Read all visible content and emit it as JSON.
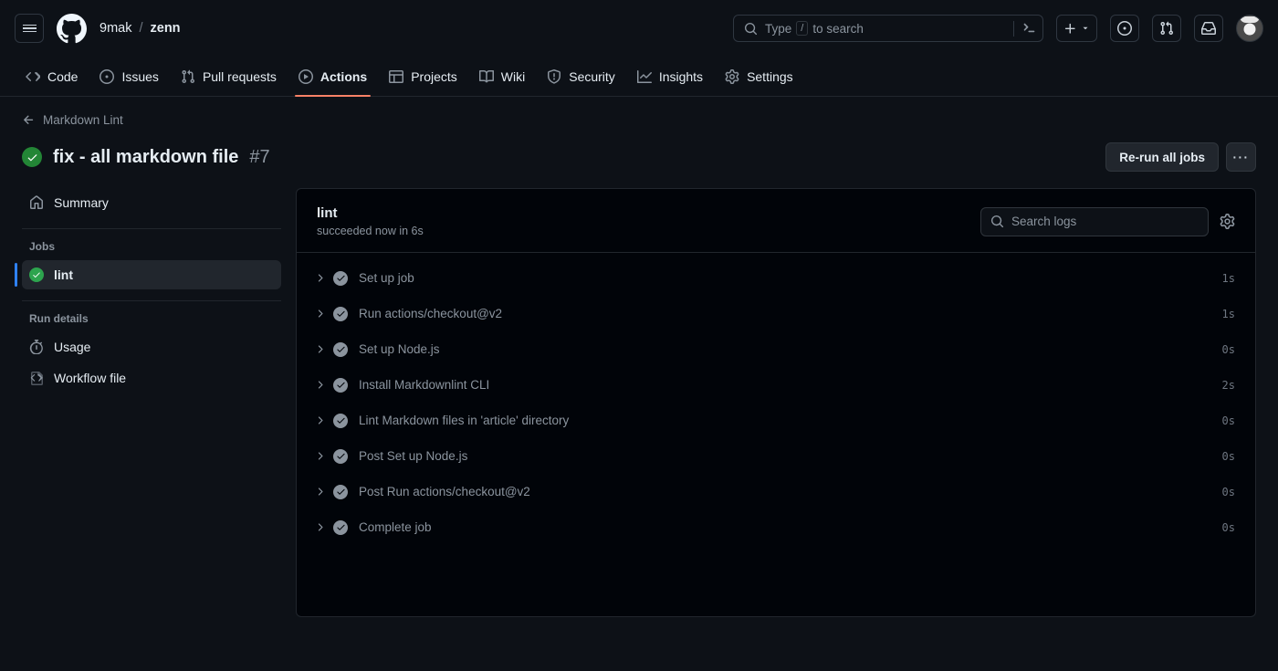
{
  "header": {
    "menu_icon": "hamburger-icon",
    "logo_icon": "github-logo-icon",
    "owner": "9mak",
    "separator": "/",
    "repo": "zenn",
    "search": {
      "placeholder_before": "Type",
      "slash_key": "/",
      "placeholder_after": "to search",
      "value": "",
      "search_icon": "search-icon",
      "terminal_icon": "terminal-icon"
    },
    "create_new_label": "+",
    "create_new_icon": "plus-icon",
    "create_new_chevron": "chevron-down-icon",
    "issues_icon": "issue-opened-icon",
    "pull_requests_icon": "git-pull-request-icon",
    "notifications_icon": "inbox-icon",
    "avatar_icon": "avatar"
  },
  "nav": {
    "items": [
      {
        "label": "Code",
        "icon": "code-icon",
        "active": false
      },
      {
        "label": "Issues",
        "icon": "issue-opened-icon",
        "active": false
      },
      {
        "label": "Pull requests",
        "icon": "git-pull-request-icon",
        "active": false
      },
      {
        "label": "Actions",
        "icon": "play-icon",
        "active": true
      },
      {
        "label": "Projects",
        "icon": "table-icon",
        "active": false
      },
      {
        "label": "Wiki",
        "icon": "book-icon",
        "active": false
      },
      {
        "label": "Security",
        "icon": "shield-icon",
        "active": false
      },
      {
        "label": "Insights",
        "icon": "graph-icon",
        "active": false
      },
      {
        "label": "Settings",
        "icon": "gear-icon",
        "active": false
      }
    ]
  },
  "run": {
    "back_label": "Markdown Lint",
    "back_icon": "arrow-left-icon",
    "status_icon": "check-circle-fill-icon",
    "title": "fix - all markdown file",
    "number": "#7",
    "rerun_label": "Re-run all jobs",
    "kebab_label": "···"
  },
  "sidebar": {
    "summary": {
      "label": "Summary",
      "icon": "home-icon"
    },
    "jobs_title": "Jobs",
    "jobs": [
      {
        "label": "lint",
        "icon": "check-circle-fill-icon",
        "selected": true
      }
    ],
    "run_details_title": "Run details",
    "details": [
      {
        "label": "Usage",
        "icon": "stopwatch-icon"
      },
      {
        "label": "Workflow file",
        "icon": "file-code-icon"
      }
    ]
  },
  "panel": {
    "title": "lint",
    "subtitle": "succeeded now in 6s",
    "search": {
      "placeholder": "Search logs",
      "value": "",
      "icon": "search-icon"
    },
    "settings_icon": "gear-icon",
    "steps": [
      {
        "name": "Set up job",
        "duration": "1s",
        "status_icon": "check-circle-fill-icon",
        "chevron": "chevron-right-icon"
      },
      {
        "name": "Run actions/checkout@v2",
        "duration": "1s",
        "status_icon": "check-circle-fill-icon",
        "chevron": "chevron-right-icon"
      },
      {
        "name": "Set up Node.js",
        "duration": "0s",
        "status_icon": "check-circle-fill-icon",
        "chevron": "chevron-right-icon"
      },
      {
        "name": "Install Markdownlint CLI",
        "duration": "2s",
        "status_icon": "check-circle-fill-icon",
        "chevron": "chevron-right-icon"
      },
      {
        "name": "Lint Markdown files in 'article' directory",
        "duration": "0s",
        "status_icon": "check-circle-fill-icon",
        "chevron": "chevron-right-icon"
      },
      {
        "name": "Post Set up Node.js",
        "duration": "0s",
        "status_icon": "check-circle-fill-icon",
        "chevron": "chevron-right-icon"
      },
      {
        "name": "Post Run actions/checkout@v2",
        "duration": "0s",
        "status_icon": "check-circle-fill-icon",
        "chevron": "chevron-right-icon"
      },
      {
        "name": "Complete job",
        "duration": "0s",
        "status_icon": "check-circle-fill-icon",
        "chevron": "chevron-right-icon"
      }
    ]
  },
  "colors": {
    "page_bg": "#0d1117",
    "panel_bg": "#010409",
    "border": "#21262d",
    "accent_active_tab": "#f78166",
    "success_green": "#2da44e",
    "selected_blue": "#2f81f7",
    "muted_text": "#8b949e"
  }
}
